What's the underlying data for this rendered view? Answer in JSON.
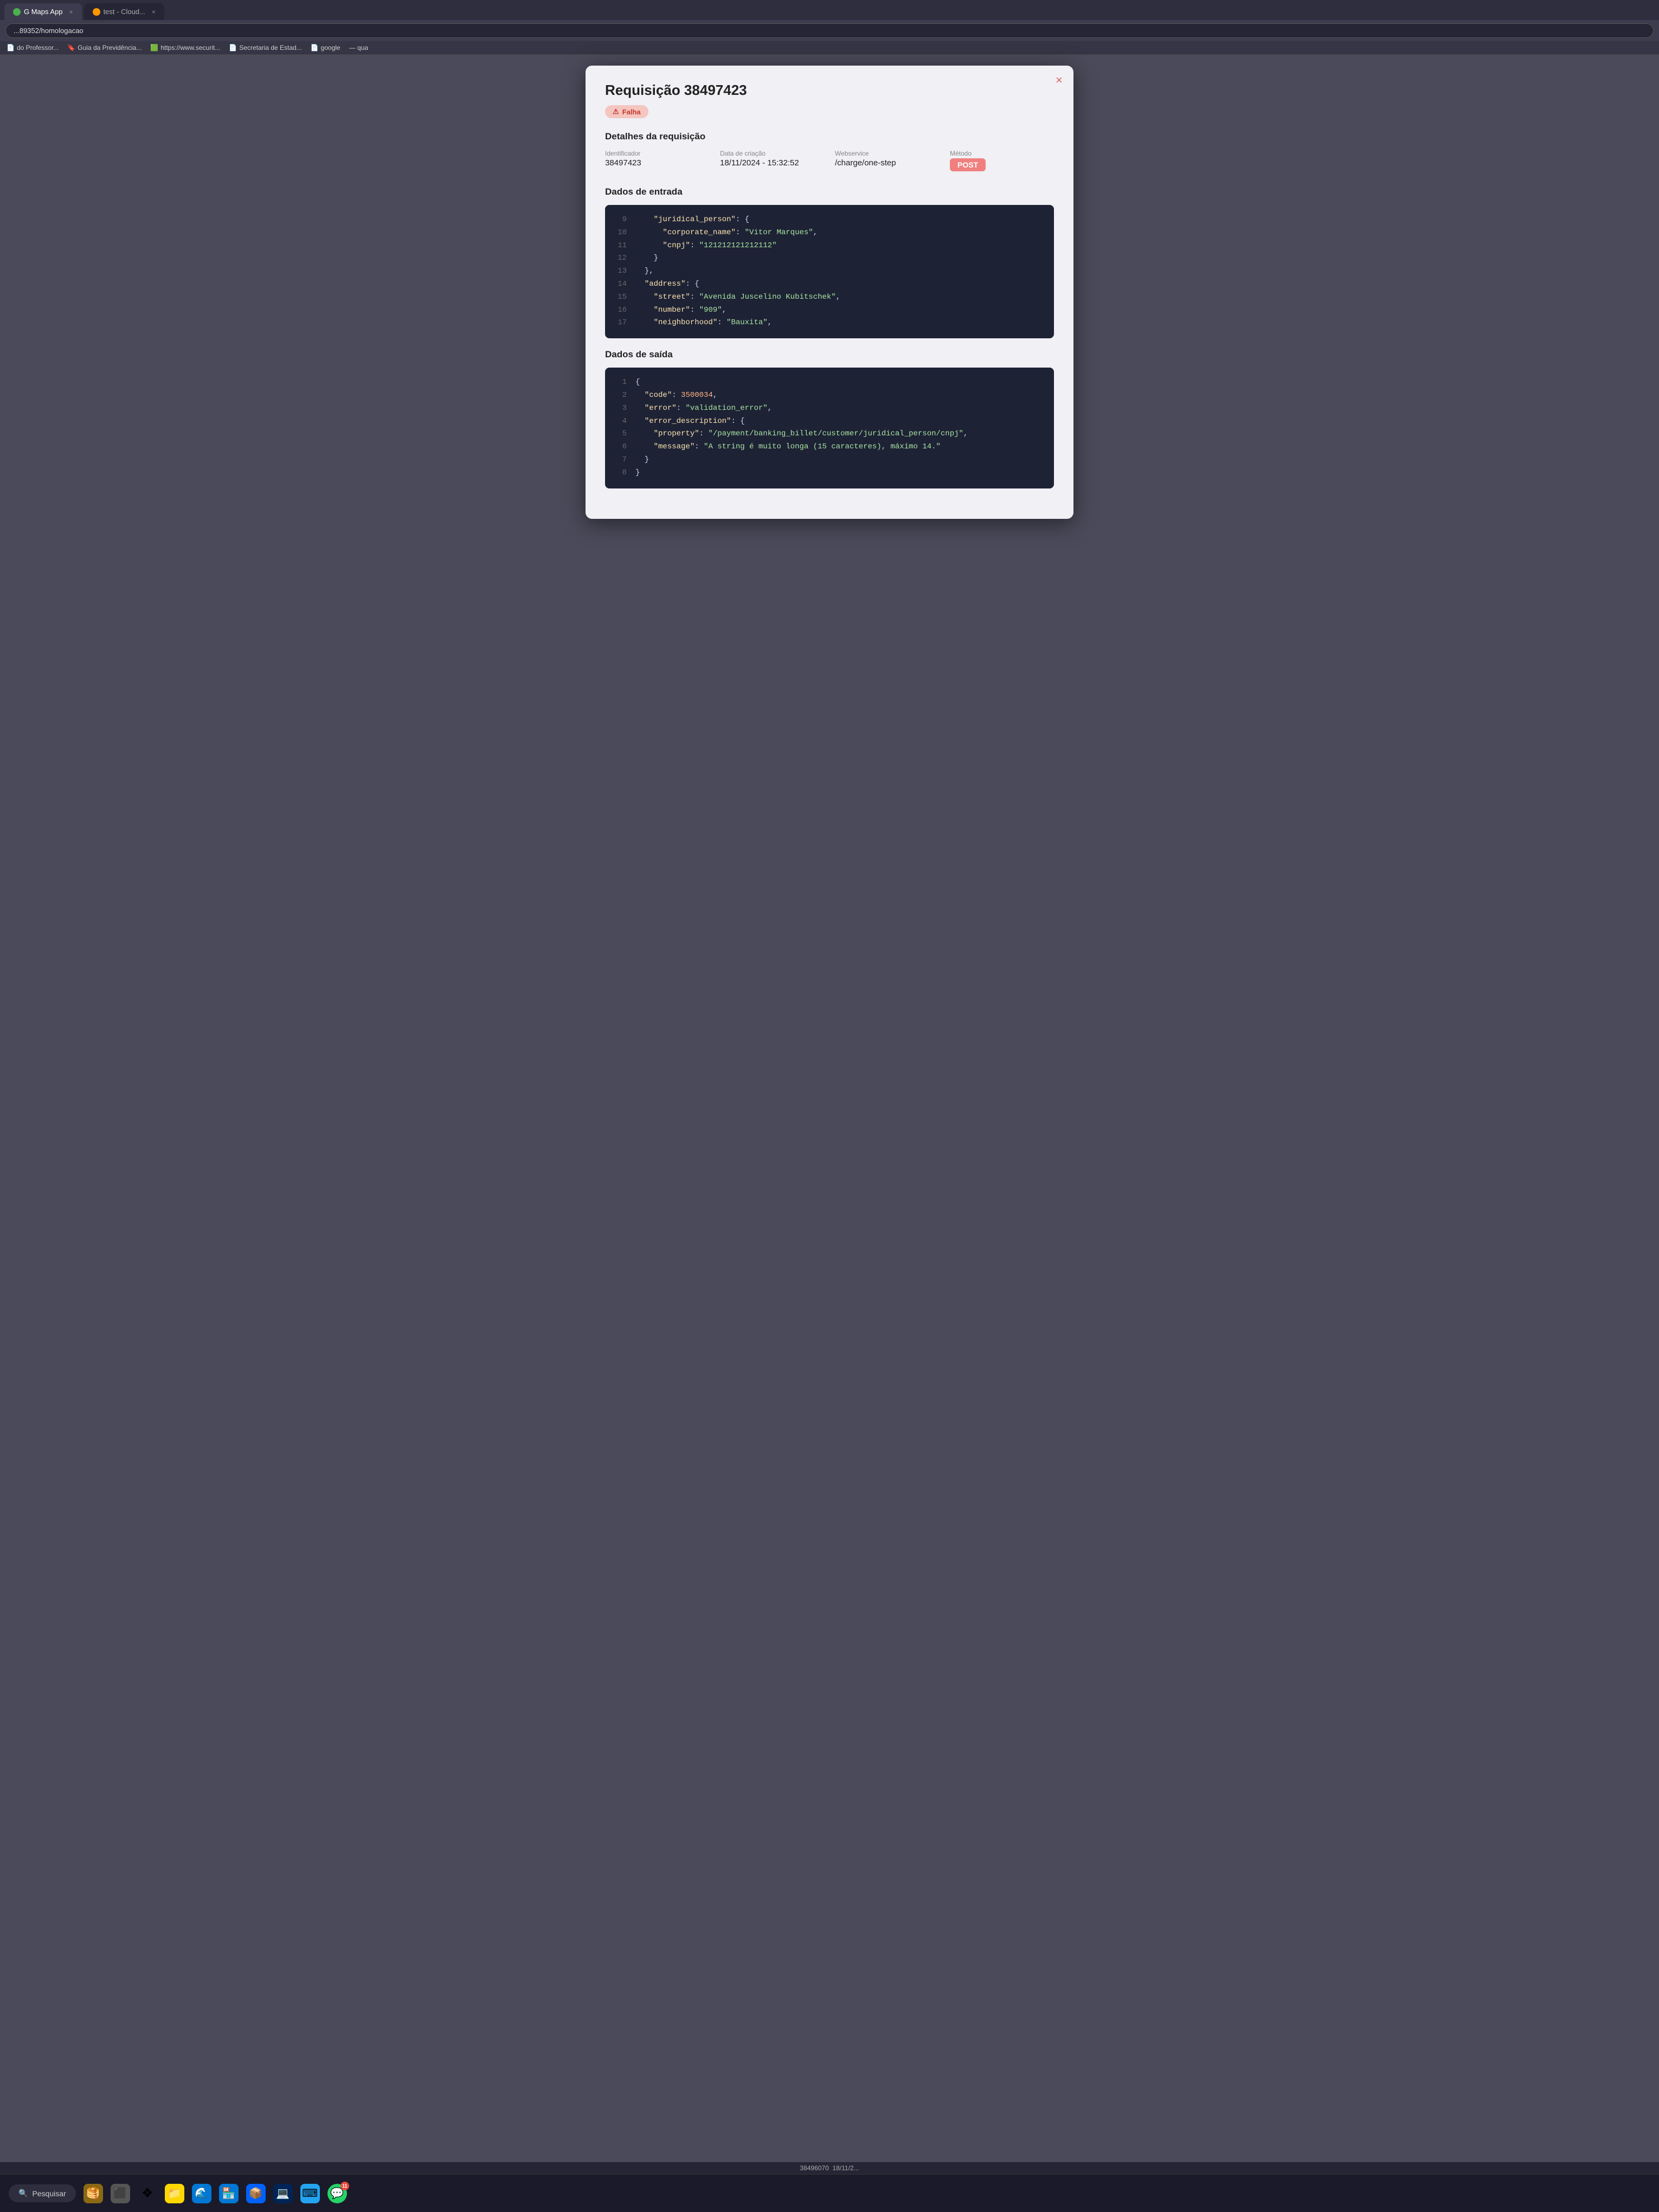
{
  "browser": {
    "tabs": [
      {
        "id": "tab1",
        "label": "G Maps App",
        "active": true,
        "icon_color": "#4CAF50"
      },
      {
        "id": "tab2",
        "label": "test - Cloud...",
        "active": false,
        "icon_color": "#FF9800"
      }
    ],
    "address_bar": "...89352/homologacao",
    "bookmarks": [
      {
        "label": "do Professor...",
        "icon": "📄"
      },
      {
        "label": "Guia da Previdência...",
        "icon": "🔖"
      },
      {
        "label": "https://www.securit...",
        "icon": "🟩"
      },
      {
        "label": "Secretaria de Estad...",
        "icon": "📄"
      },
      {
        "label": "google",
        "icon": "📄"
      },
      {
        "label": "— qua",
        "icon": ""
      }
    ]
  },
  "modal": {
    "title": "Requisição 38497423",
    "close_label": "×",
    "status_badge": "⚠ Falha",
    "sections": {
      "details": {
        "title": "Detalhes da requisição",
        "fields": [
          {
            "label": "Identificador",
            "value": "38497423"
          },
          {
            "label": "Data de criação",
            "value": "18/11/2024 - 15:32:52"
          },
          {
            "label": "Webservice",
            "value": "/charge/one-step"
          },
          {
            "label": "Método",
            "value": "POST",
            "is_badge": true
          }
        ]
      },
      "input_data": {
        "title": "Dados de entrada",
        "lines": [
          {
            "num": "9",
            "content": "    \"juridical_person\": {",
            "type": "key_brace"
          },
          {
            "num": "10",
            "content": "      \"corporate_name\": \"Vitor Marques\",",
            "type": "key_val"
          },
          {
            "num": "11",
            "content": "      \"cnpj\": \"121212121212112\"",
            "type": "key_val"
          },
          {
            "num": "12",
            "content": "    }",
            "type": "brace"
          },
          {
            "num": "13",
            "content": "  },",
            "type": "brace"
          },
          {
            "num": "14",
            "content": "  \"address\": {",
            "type": "key_brace"
          },
          {
            "num": "15",
            "content": "    \"street\": \"Avenida Juscelino Kubitschek\",",
            "type": "key_val"
          },
          {
            "num": "16",
            "content": "    \"number\": \"909\",",
            "type": "key_val"
          },
          {
            "num": "17",
            "content": "    \"neighborhood\": \"Bauxita\",",
            "type": "key_val"
          }
        ]
      },
      "output_data": {
        "title": "Dados de saída",
        "lines": [
          {
            "num": "1",
            "content": "{",
            "type": "brace"
          },
          {
            "num": "2",
            "content": "  \"code\": 3500034,",
            "type": "key_num"
          },
          {
            "num": "3",
            "content": "  \"error\": \"validation_error\",",
            "type": "key_val"
          },
          {
            "num": "4",
            "content": "  \"error_description\": {",
            "type": "key_brace"
          },
          {
            "num": "5",
            "content": "    \"property\": \"/payment/banking_billet/customer/juridical_person/cnpj\",",
            "type": "key_val"
          },
          {
            "num": "6",
            "content": "    \"message\": \"A string é muito longa (15 caracteres), máximo 14.\"",
            "type": "key_val"
          },
          {
            "num": "7",
            "content": "  }",
            "type": "brace"
          },
          {
            "num": "8",
            "content": "}",
            "type": "brace"
          }
        ]
      }
    }
  },
  "bottom_strip": {
    "item_id": "38496070",
    "date": "18/11/2..."
  },
  "taskbar": {
    "search_placeholder": "Pesquisar",
    "icons": [
      {
        "id": "pancakes",
        "symbol": "🥞",
        "bg": "#8B6914"
      },
      {
        "id": "task-view",
        "symbol": "⬛",
        "bg": "#444"
      },
      {
        "id": "windows",
        "symbol": "❖",
        "bg": "transparent"
      },
      {
        "id": "file-explorer",
        "symbol": "📁",
        "bg": "#FFD700"
      },
      {
        "id": "edge",
        "symbol": "🌊",
        "bg": "#0078D4"
      },
      {
        "id": "store",
        "symbol": "🏪",
        "bg": "#0078D4"
      },
      {
        "id": "dropbox",
        "symbol": "📦",
        "bg": "#0061FE"
      },
      {
        "id": "terminal",
        "symbol": "💻",
        "bg": "#012456"
      },
      {
        "id": "vscode",
        "symbol": "⌨",
        "bg": "#23A3F0"
      },
      {
        "id": "whatsapp",
        "symbol": "💬",
        "bg": "#25D366",
        "badge": "11"
      }
    ]
  },
  "colors": {
    "modal_bg": "#f0f0f5",
    "code_bg": "#1e2235",
    "status_badge_bg": "#f5c5c0",
    "status_badge_text": "#c0392b",
    "method_badge_bg": "#f08080",
    "key_color": "#f9e2af",
    "val_color": "#a6e3a1",
    "num_color": "#fab387",
    "text_color": "#cdd6f4",
    "linenum_color": "#666677"
  }
}
